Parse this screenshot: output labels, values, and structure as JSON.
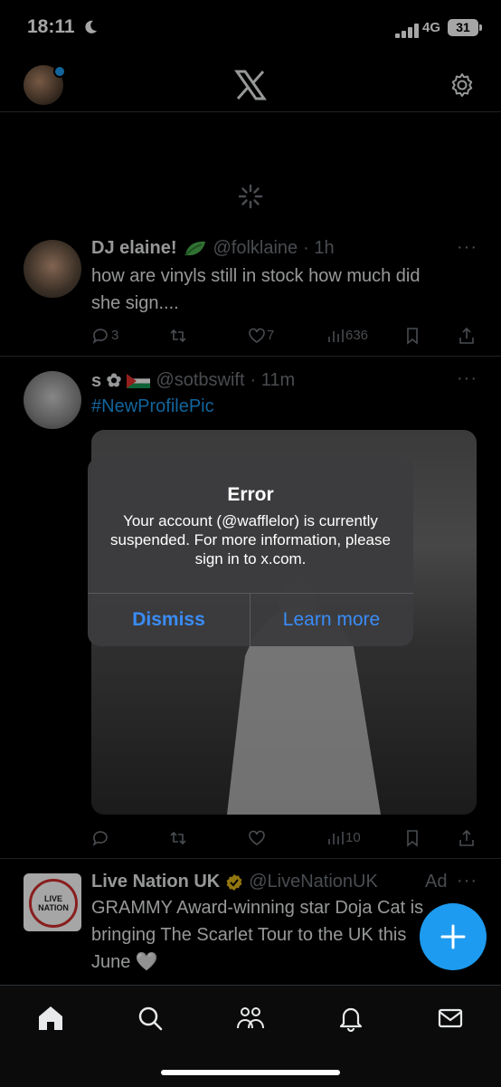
{
  "status_bar": {
    "time": "18:11",
    "network": "4G",
    "battery": "31"
  },
  "header": {
    "logo": "x-logo-icon",
    "settings": "gear-icon"
  },
  "tweets": [
    {
      "name": "DJ elaine!",
      "handle": "@folklaine",
      "time": "· 1h",
      "text_line1": "how are vinyls still in stock how much did",
      "text_line2": "she sign....",
      "replies": "3",
      "likes": "7",
      "views": "636"
    },
    {
      "name": "s ✿ ",
      "handle": "@sotbswift",
      "time": "· 11m",
      "hashtag": "#NewProfilePic",
      "views": "10"
    },
    {
      "name": "Live Nation UK",
      "handle": "@LiveNationUK",
      "ad_label": "Ad",
      "text_line1": "GRAMMY Award-winning star Doja Cat is",
      "text_line2": "bringing The Scarlet Tour to the UK this",
      "text_line3": "June 🤍",
      "logo_text": "LIVE NATION"
    }
  ],
  "alert": {
    "title": "Error",
    "message": "Your account (@wafflelor) is currently suspended. For more information, please sign in to x.com.",
    "dismiss_label": "Dismiss",
    "learn_more_label": "Learn more"
  },
  "tabs": [
    "home-icon",
    "search-icon",
    "communities-icon",
    "notifications-icon",
    "messages-icon"
  ],
  "colors": {
    "accent": "#1d9bf0",
    "alert_button": "#3a8cf7",
    "background": "#000000"
  }
}
